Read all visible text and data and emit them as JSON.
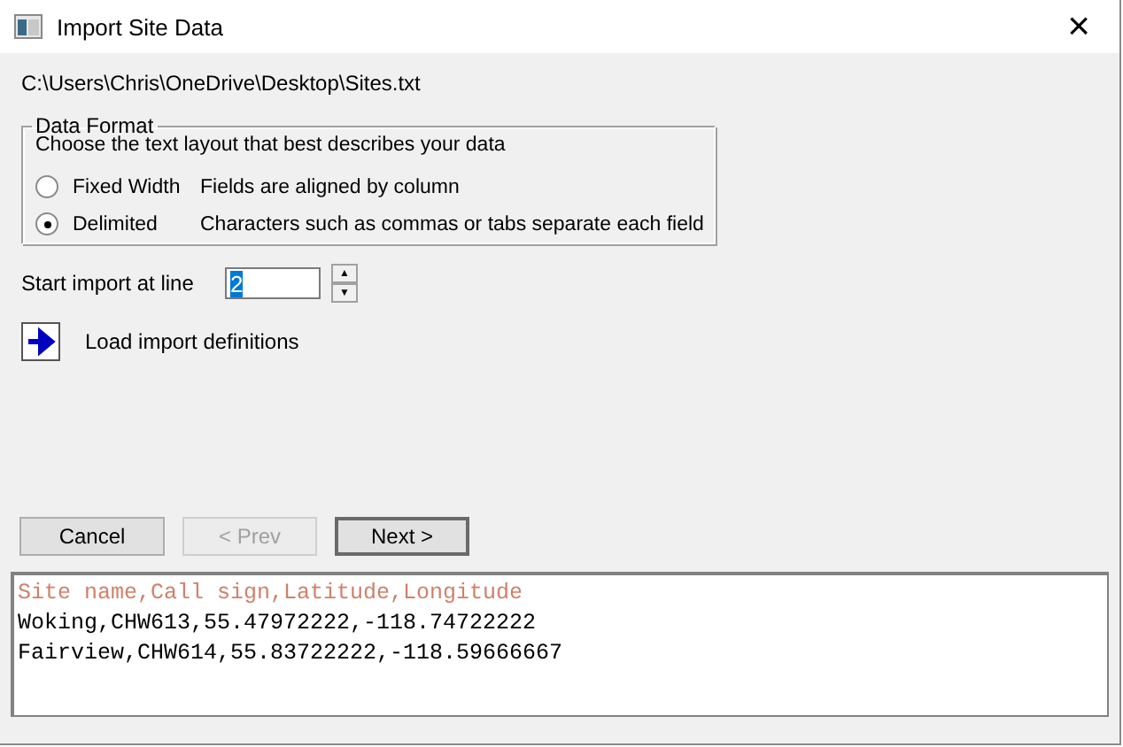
{
  "window": {
    "title": "Import Site Data",
    "close": "×"
  },
  "file_path": "C:\\Users\\Chris\\OneDrive\\Desktop\\Sites.txt",
  "data_format": {
    "title": "Data Format",
    "prompt": "Choose the text layout that best describes your data",
    "options": [
      {
        "label": "Fixed Width",
        "description": "Fields are aligned by column",
        "selected": false
      },
      {
        "label": "Delimited",
        "description": "Characters such as commas or tabs separate each field",
        "selected": true
      }
    ]
  },
  "start_line": {
    "label": "Start import at line",
    "value": "2",
    "up": "▲",
    "down": "▼"
  },
  "load_definitions": {
    "label": "Load import definitions"
  },
  "buttons": [
    {
      "label": "Cancel",
      "disabled": false,
      "default": false
    },
    {
      "label": "< Prev",
      "disabled": true,
      "default": false
    },
    {
      "label": "Next >",
      "disabled": false,
      "default": true
    }
  ],
  "preview": [
    {
      "kind": "header",
      "text": "Site name,Call sign,Latitude,Longitude"
    },
    {
      "kind": "data",
      "text": "Woking,CHW613,55.47972222,-118.74722222"
    },
    {
      "kind": "data",
      "text": "Fairview,CHW614,55.83722222,-118.59666667"
    }
  ]
}
